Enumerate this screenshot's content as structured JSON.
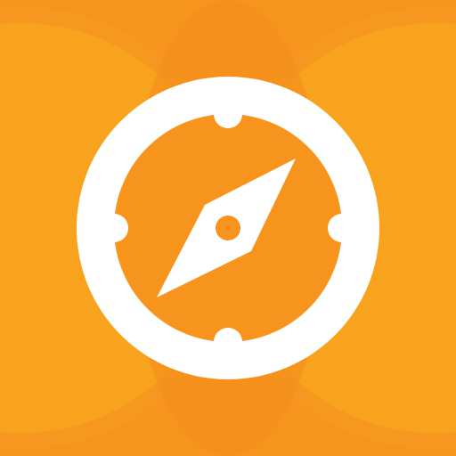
{
  "icon": {
    "name": "compass-app-icon",
    "glyph": "compass-icon",
    "colors": {
      "background": "#f7941d",
      "side_glow": "#fbab1a",
      "ring_band": "#f59b22",
      "center_band": "#f58f1c",
      "foreground": "#ffffff"
    }
  }
}
